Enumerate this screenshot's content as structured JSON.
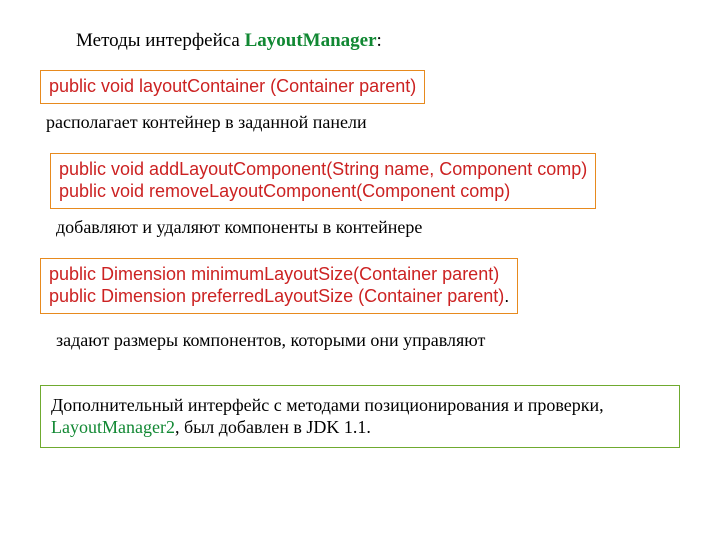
{
  "heading": {
    "prefix": "Методы интерфейса ",
    "keyword": "LayoutManager",
    "suffix": ":"
  },
  "box1": {
    "line1": "public void layoutContainer (Container parent)"
  },
  "desc1": "располагает контейнер в заданной панели",
  "box2": {
    "line1": "public void addLayoutComponent(String name, Component comp)",
    "line2": "public void removeLayoutComponent(Component comp)"
  },
  "desc2": "добавляют и удаляют компоненты в контейнере",
  "box3": {
    "line1": "public Dimension minimumLayoutSize(Container parent)",
    "line2": "public Dimension preferredLayoutSize (Container parent)",
    "dot": "."
  },
  "desc3": "задают размеры компонентов, которыми они управляют",
  "box4": {
    "text_before": "Дополнительный интерфейс с методами позиционирования и проверки, ",
    "keyword": "LayoutManager2",
    "text_after": ",  был добавлен в JDK 1.1."
  }
}
